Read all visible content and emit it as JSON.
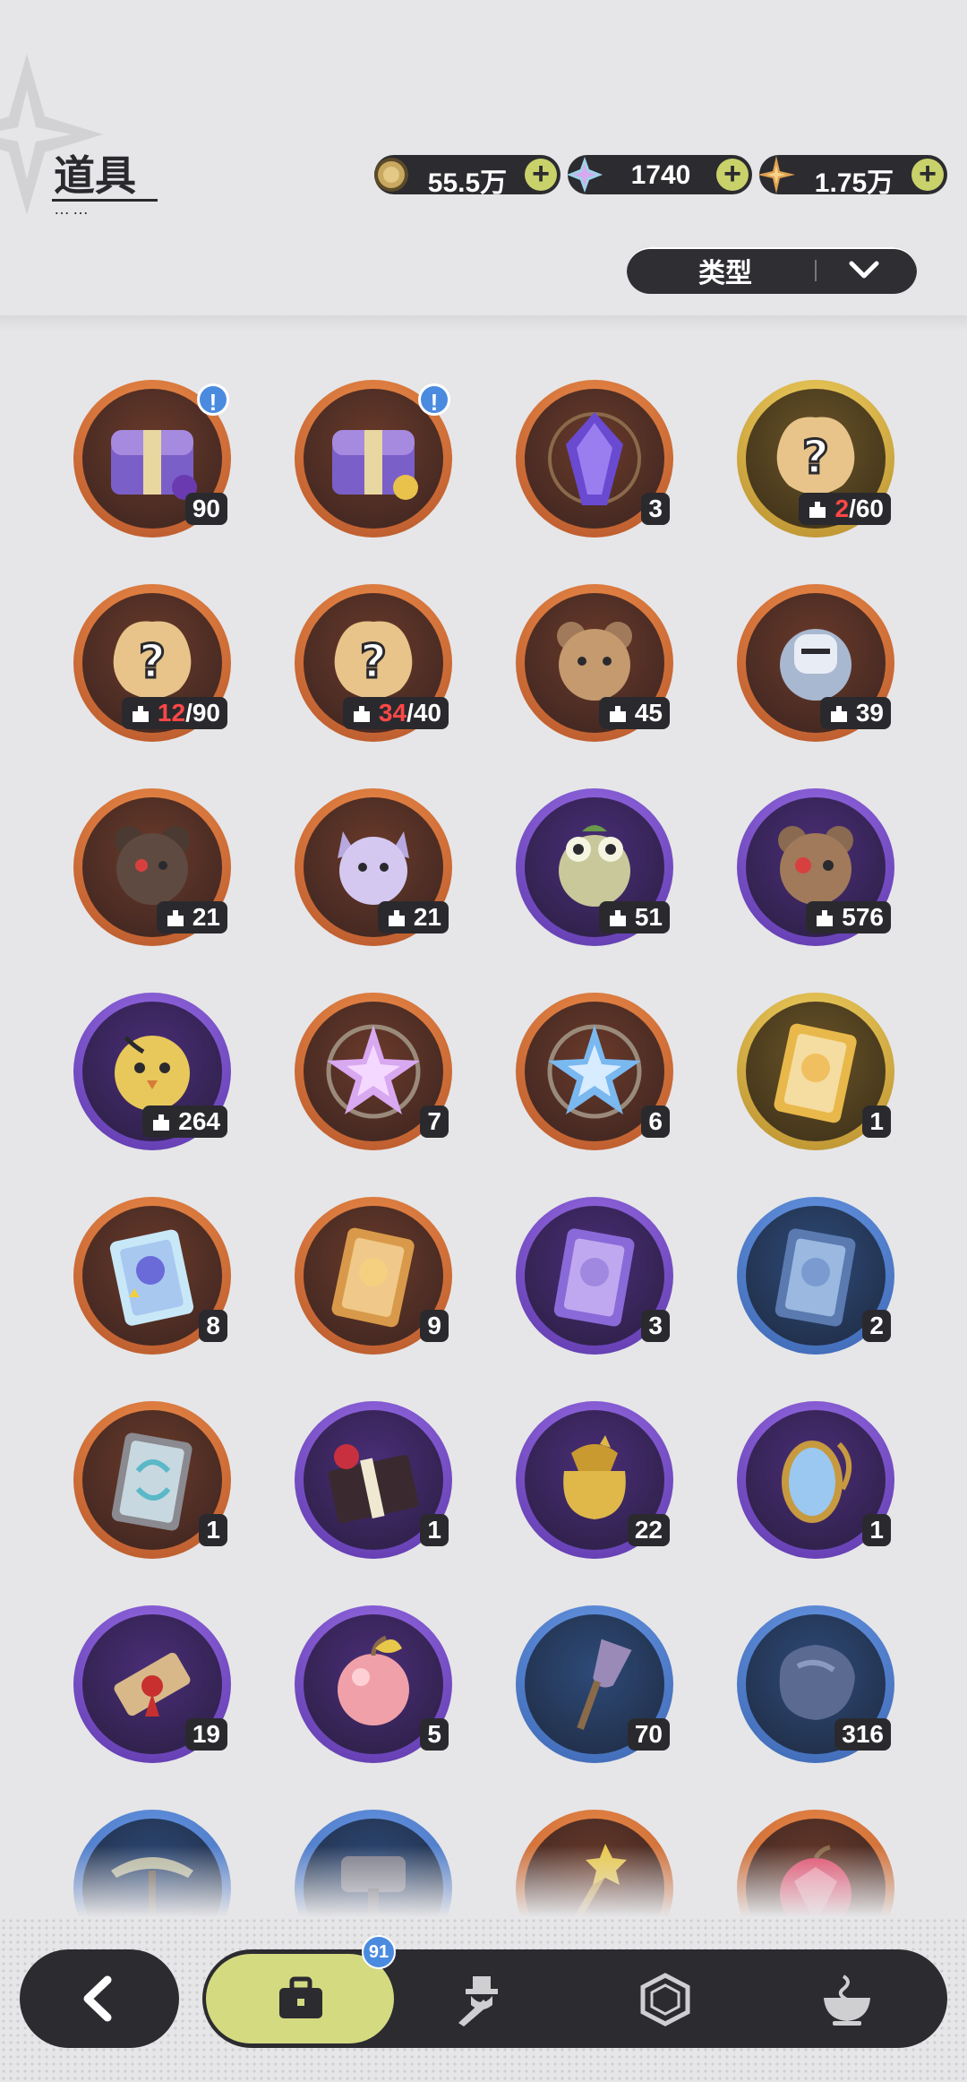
{
  "header": {
    "title": "道具"
  },
  "currencies": [
    {
      "name": "coin",
      "value": "55.5万",
      "color": "#c9a860"
    },
    {
      "name": "crystal",
      "value": "1740",
      "color": "#9fd3e8"
    },
    {
      "name": "star-shard",
      "value": "1.75万",
      "color": "#e0a050"
    }
  ],
  "filter": {
    "label": "类型"
  },
  "items": [
    {
      "name": "purple-treasure-chest",
      "count": "90",
      "frame": "orange",
      "art": "chest-purple",
      "alert": "!"
    },
    {
      "name": "gold-treasure-chest",
      "count": "",
      "frame": "orange",
      "art": "chest-gold",
      "alert": "!"
    },
    {
      "name": "purple-crystal-chip",
      "count": "3",
      "frame": "orange",
      "art": "crystal-violet"
    },
    {
      "name": "unknown-fragment-gold",
      "frag_have": "2",
      "frag_need": "/60",
      "frame": "gold",
      "art": "mystery"
    },
    {
      "name": "unknown-fragment-orange-a",
      "frag_have": "12",
      "frag_need": "/90",
      "frame": "orange",
      "art": "mystery"
    },
    {
      "name": "unknown-fragment-orange-b",
      "frag_have": "34",
      "frag_need": "/40",
      "frame": "orange",
      "art": "mystery"
    },
    {
      "name": "bear-fragment",
      "frag_count": "45",
      "frame": "orange",
      "art": "bear-brown"
    },
    {
      "name": "knight-fragment",
      "frag_count": "39",
      "frame": "orange",
      "art": "knight"
    },
    {
      "name": "dark-bear-fragment",
      "frag_count": "21",
      "frame": "orange",
      "art": "bear-dark"
    },
    {
      "name": "cat-fragment",
      "frag_count": "21",
      "frame": "orange",
      "art": "cat-lilac"
    },
    {
      "name": "frog-fragment",
      "frag_count": "51",
      "frame": "purple",
      "art": "frog"
    },
    {
      "name": "red-eye-bear-fragment",
      "frag_count": "576",
      "frame": "purple",
      "art": "bear-redeye"
    },
    {
      "name": "chick-fragment",
      "frag_count": "264",
      "frame": "purple",
      "art": "chick"
    },
    {
      "name": "pink-star-crystal",
      "count": "7",
      "frame": "orange",
      "art": "star-pink"
    },
    {
      "name": "blue-star-crystal",
      "count": "6",
      "frame": "orange",
      "art": "star-blue"
    },
    {
      "name": "gold-character-card",
      "count": "1",
      "frame": "gold",
      "art": "card-gold"
    },
    {
      "name": "rainbow-character-card",
      "count": "8",
      "frame": "orange",
      "art": "card-rainbow"
    },
    {
      "name": "orange-character-card",
      "count": "9",
      "frame": "orange",
      "art": "card-orange"
    },
    {
      "name": "purple-character-card",
      "count": "3",
      "frame": "purple",
      "art": "card-purple"
    },
    {
      "name": "blue-character-card",
      "count": "2",
      "frame": "blue",
      "art": "card-blue"
    },
    {
      "name": "swap-card",
      "count": "1",
      "frame": "orange",
      "art": "card-swap"
    },
    {
      "name": "gift-box",
      "count": "1",
      "frame": "purple",
      "art": "gift"
    },
    {
      "name": "golden-pouch",
      "count": "22",
      "frame": "purple",
      "art": "pouch"
    },
    {
      "name": "magic-mirror",
      "count": "1",
      "frame": "purple",
      "art": "mirror"
    },
    {
      "name": "scroll",
      "count": "19",
      "frame": "purple",
      "art": "scroll"
    },
    {
      "name": "pink-apple",
      "count": "5",
      "frame": "purple",
      "art": "apple"
    },
    {
      "name": "shovel",
      "count": "70",
      "frame": "blue",
      "art": "shovel"
    },
    {
      "name": "stone-ore",
      "count": "316",
      "frame": "blue",
      "art": "ore"
    },
    {
      "name": "pickaxe",
      "count": "",
      "frame": "blue",
      "art": "pickaxe"
    },
    {
      "name": "hammer",
      "count": "",
      "frame": "blue",
      "art": "hammer"
    },
    {
      "name": "golden-wand",
      "count": "",
      "frame": "orange",
      "art": "wand"
    },
    {
      "name": "ruby-fruit",
      "count": "",
      "frame": "orange",
      "art": "ruby"
    }
  ],
  "bottom_nav": {
    "bag_badge": "91",
    "tabs": [
      {
        "name": "bag",
        "icon": "briefcase-icon"
      },
      {
        "name": "equipment",
        "icon": "sword-hat-icon"
      },
      {
        "name": "gems",
        "icon": "hexagon-gem-icon"
      },
      {
        "name": "food",
        "icon": "bowl-icon"
      }
    ]
  },
  "colors": {
    "frame_orange": "#e07a3a",
    "frame_purple": "#7b4fd6",
    "frame_gold": "#e3b93a",
    "frame_blue": "#4d7fd0",
    "accent": "#d4da80",
    "dark": "#2b2b30"
  }
}
